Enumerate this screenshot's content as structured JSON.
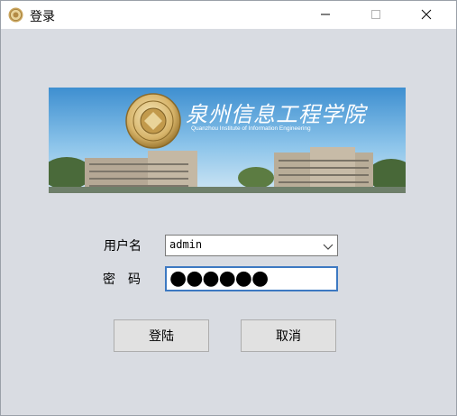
{
  "window": {
    "title": "登录",
    "icon": "school-seal-icon",
    "controls": {
      "minimize": "minimize-icon",
      "maximize": "maximize-icon",
      "close": "close-icon"
    }
  },
  "banner": {
    "school_name": "泉州信息工程学院",
    "school_name_en": "Quanzhou Institute of Information Engineering"
  },
  "form": {
    "username_label": "用户名",
    "username_value": "admin",
    "password_label": "密　码",
    "password_mask": "●●●●●●"
  },
  "buttons": {
    "login": "登陆",
    "cancel": "取消"
  },
  "colors": {
    "window_bg": "#d9dce2",
    "focus_border": "#3d79c2",
    "button_bg": "#e1e1e1"
  }
}
